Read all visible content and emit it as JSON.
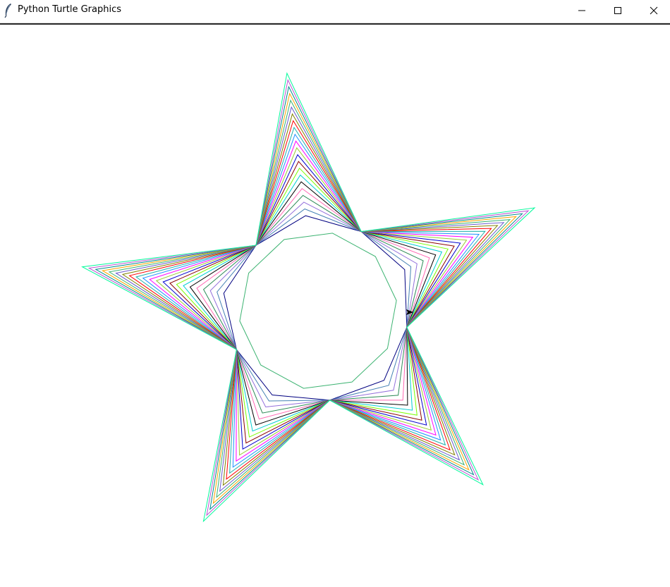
{
  "window": {
    "title": "Python Turtle Graphics",
    "icon": "feather-icon",
    "controls": [
      {
        "name": "minimize",
        "icon": "minimize-icon"
      },
      {
        "name": "maximize",
        "icon": "maximize-icon"
      },
      {
        "name": "close",
        "icon": "close-icon"
      }
    ]
  },
  "drawing": {
    "shape": "five-pointed star of nested zigzag outlines",
    "layers": 22,
    "cursor": "turtle-arrow",
    "colors": [
      "#000080",
      "#4682b4",
      "#9370db",
      "#2e8b57",
      "#ff69b4",
      "#000000",
      "#00ced1",
      "#7cfc00",
      "#8b0000",
      "#0000cd",
      "#9acd32",
      "#ff00ff",
      "#1e90ff",
      "#20b2aa",
      "#ff0000",
      "#808000",
      "#6a5acd",
      "#3cb371",
      "#ffa500",
      "#008b8b",
      "#ba55d3",
      "#00fa9a"
    ]
  }
}
